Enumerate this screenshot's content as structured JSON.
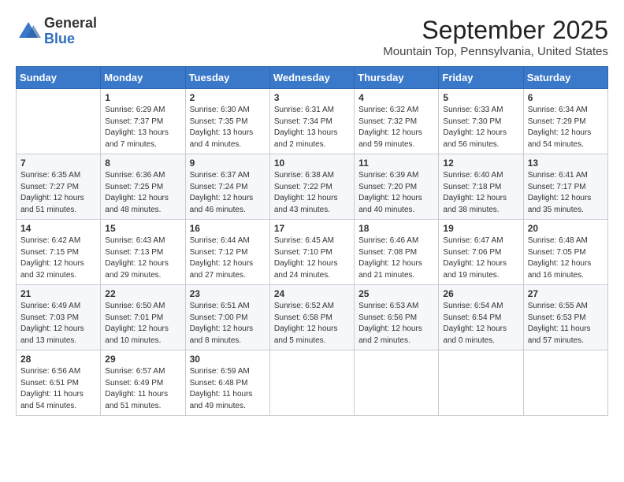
{
  "header": {
    "logo_line1": "General",
    "logo_line2": "Blue",
    "title": "September 2025",
    "subtitle": "Mountain Top, Pennsylvania, United States"
  },
  "days_of_week": [
    "Sunday",
    "Monday",
    "Tuesday",
    "Wednesday",
    "Thursday",
    "Friday",
    "Saturday"
  ],
  "weeks": [
    [
      {
        "date": "",
        "sunrise": "",
        "sunset": "",
        "daylight": ""
      },
      {
        "date": "1",
        "sunrise": "Sunrise: 6:29 AM",
        "sunset": "Sunset: 7:37 PM",
        "daylight": "Daylight: 13 hours and 7 minutes."
      },
      {
        "date": "2",
        "sunrise": "Sunrise: 6:30 AM",
        "sunset": "Sunset: 7:35 PM",
        "daylight": "Daylight: 13 hours and 4 minutes."
      },
      {
        "date": "3",
        "sunrise": "Sunrise: 6:31 AM",
        "sunset": "Sunset: 7:34 PM",
        "daylight": "Daylight: 13 hours and 2 minutes."
      },
      {
        "date": "4",
        "sunrise": "Sunrise: 6:32 AM",
        "sunset": "Sunset: 7:32 PM",
        "daylight": "Daylight: 12 hours and 59 minutes."
      },
      {
        "date": "5",
        "sunrise": "Sunrise: 6:33 AM",
        "sunset": "Sunset: 7:30 PM",
        "daylight": "Daylight: 12 hours and 56 minutes."
      },
      {
        "date": "6",
        "sunrise": "Sunrise: 6:34 AM",
        "sunset": "Sunset: 7:29 PM",
        "daylight": "Daylight: 12 hours and 54 minutes."
      }
    ],
    [
      {
        "date": "7",
        "sunrise": "Sunrise: 6:35 AM",
        "sunset": "Sunset: 7:27 PM",
        "daylight": "Daylight: 12 hours and 51 minutes."
      },
      {
        "date": "8",
        "sunrise": "Sunrise: 6:36 AM",
        "sunset": "Sunset: 7:25 PM",
        "daylight": "Daylight: 12 hours and 48 minutes."
      },
      {
        "date": "9",
        "sunrise": "Sunrise: 6:37 AM",
        "sunset": "Sunset: 7:24 PM",
        "daylight": "Daylight: 12 hours and 46 minutes."
      },
      {
        "date": "10",
        "sunrise": "Sunrise: 6:38 AM",
        "sunset": "Sunset: 7:22 PM",
        "daylight": "Daylight: 12 hours and 43 minutes."
      },
      {
        "date": "11",
        "sunrise": "Sunrise: 6:39 AM",
        "sunset": "Sunset: 7:20 PM",
        "daylight": "Daylight: 12 hours and 40 minutes."
      },
      {
        "date": "12",
        "sunrise": "Sunrise: 6:40 AM",
        "sunset": "Sunset: 7:18 PM",
        "daylight": "Daylight: 12 hours and 38 minutes."
      },
      {
        "date": "13",
        "sunrise": "Sunrise: 6:41 AM",
        "sunset": "Sunset: 7:17 PM",
        "daylight": "Daylight: 12 hours and 35 minutes."
      }
    ],
    [
      {
        "date": "14",
        "sunrise": "Sunrise: 6:42 AM",
        "sunset": "Sunset: 7:15 PM",
        "daylight": "Daylight: 12 hours and 32 minutes."
      },
      {
        "date": "15",
        "sunrise": "Sunrise: 6:43 AM",
        "sunset": "Sunset: 7:13 PM",
        "daylight": "Daylight: 12 hours and 29 minutes."
      },
      {
        "date": "16",
        "sunrise": "Sunrise: 6:44 AM",
        "sunset": "Sunset: 7:12 PM",
        "daylight": "Daylight: 12 hours and 27 minutes."
      },
      {
        "date": "17",
        "sunrise": "Sunrise: 6:45 AM",
        "sunset": "Sunset: 7:10 PM",
        "daylight": "Daylight: 12 hours and 24 minutes."
      },
      {
        "date": "18",
        "sunrise": "Sunrise: 6:46 AM",
        "sunset": "Sunset: 7:08 PM",
        "daylight": "Daylight: 12 hours and 21 minutes."
      },
      {
        "date": "19",
        "sunrise": "Sunrise: 6:47 AM",
        "sunset": "Sunset: 7:06 PM",
        "daylight": "Daylight: 12 hours and 19 minutes."
      },
      {
        "date": "20",
        "sunrise": "Sunrise: 6:48 AM",
        "sunset": "Sunset: 7:05 PM",
        "daylight": "Daylight: 12 hours and 16 minutes."
      }
    ],
    [
      {
        "date": "21",
        "sunrise": "Sunrise: 6:49 AM",
        "sunset": "Sunset: 7:03 PM",
        "daylight": "Daylight: 12 hours and 13 minutes."
      },
      {
        "date": "22",
        "sunrise": "Sunrise: 6:50 AM",
        "sunset": "Sunset: 7:01 PM",
        "daylight": "Daylight: 12 hours and 10 minutes."
      },
      {
        "date": "23",
        "sunrise": "Sunrise: 6:51 AM",
        "sunset": "Sunset: 7:00 PM",
        "daylight": "Daylight: 12 hours and 8 minutes."
      },
      {
        "date": "24",
        "sunrise": "Sunrise: 6:52 AM",
        "sunset": "Sunset: 6:58 PM",
        "daylight": "Daylight: 12 hours and 5 minutes."
      },
      {
        "date": "25",
        "sunrise": "Sunrise: 6:53 AM",
        "sunset": "Sunset: 6:56 PM",
        "daylight": "Daylight: 12 hours and 2 minutes."
      },
      {
        "date": "26",
        "sunrise": "Sunrise: 6:54 AM",
        "sunset": "Sunset: 6:54 PM",
        "daylight": "Daylight: 12 hours and 0 minutes."
      },
      {
        "date": "27",
        "sunrise": "Sunrise: 6:55 AM",
        "sunset": "Sunset: 6:53 PM",
        "daylight": "Daylight: 11 hours and 57 minutes."
      }
    ],
    [
      {
        "date": "28",
        "sunrise": "Sunrise: 6:56 AM",
        "sunset": "Sunset: 6:51 PM",
        "daylight": "Daylight: 11 hours and 54 minutes."
      },
      {
        "date": "29",
        "sunrise": "Sunrise: 6:57 AM",
        "sunset": "Sunset: 6:49 PM",
        "daylight": "Daylight: 11 hours and 51 minutes."
      },
      {
        "date": "30",
        "sunrise": "Sunrise: 6:59 AM",
        "sunset": "Sunset: 6:48 PM",
        "daylight": "Daylight: 11 hours and 49 minutes."
      },
      {
        "date": "",
        "sunrise": "",
        "sunset": "",
        "daylight": ""
      },
      {
        "date": "",
        "sunrise": "",
        "sunset": "",
        "daylight": ""
      },
      {
        "date": "",
        "sunrise": "",
        "sunset": "",
        "daylight": ""
      },
      {
        "date": "",
        "sunrise": "",
        "sunset": "",
        "daylight": ""
      }
    ]
  ]
}
